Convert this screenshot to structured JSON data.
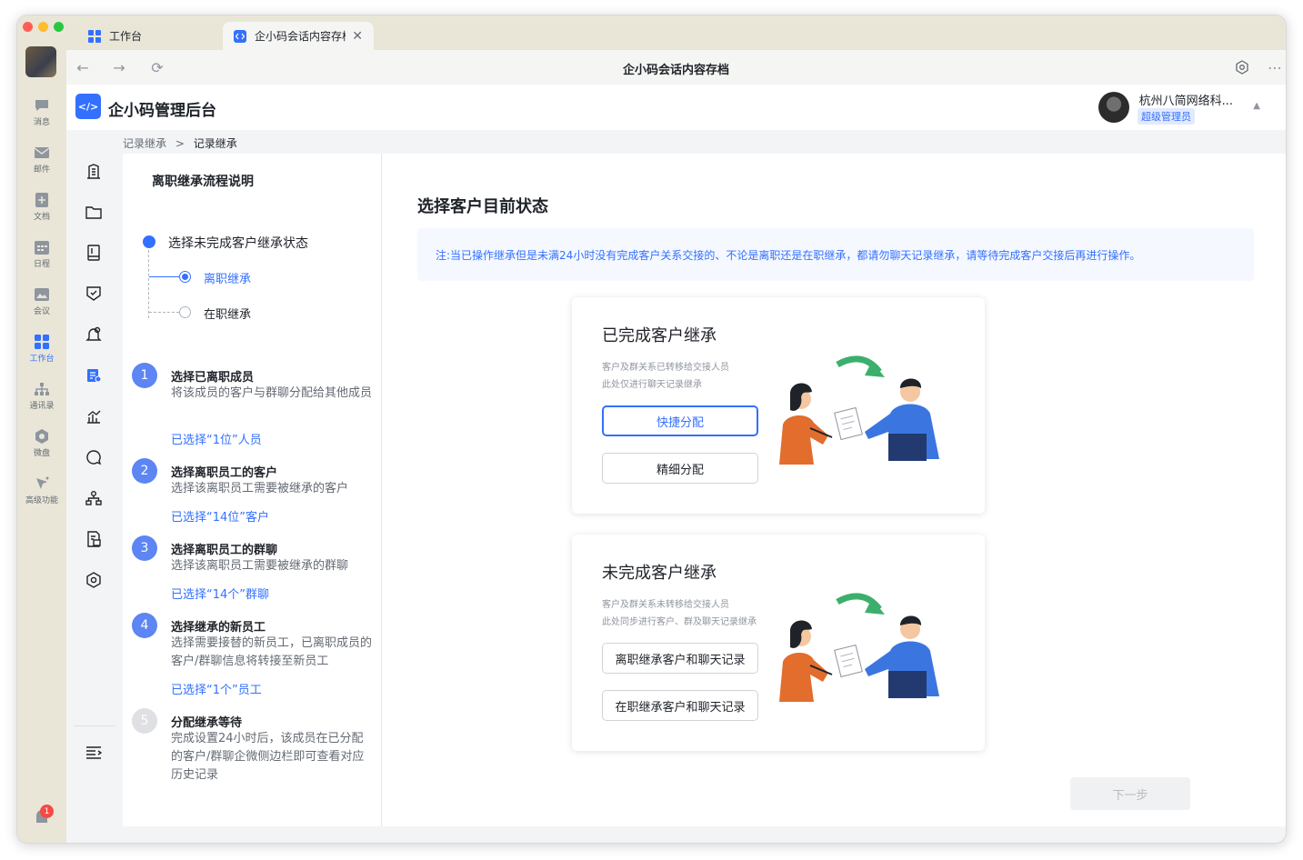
{
  "window": {
    "tabs": [
      {
        "label": "工作台",
        "icon": "grid-icon"
      },
      {
        "label": "企小码会话内容存档",
        "icon": "code-icon"
      }
    ],
    "title": "企小码会话内容存档"
  },
  "rail": {
    "items": [
      {
        "label": "消息",
        "icon": "chat-icon"
      },
      {
        "label": "邮件",
        "icon": "mail-icon"
      },
      {
        "label": "文档",
        "icon": "doc-icon"
      },
      {
        "label": "日程",
        "icon": "calendar-icon"
      },
      {
        "label": "会议",
        "icon": "meeting-icon"
      },
      {
        "label": "工作台",
        "icon": "grid-icon"
      },
      {
        "label": "通讯录",
        "icon": "org-icon"
      },
      {
        "label": "微盘",
        "icon": "drive-icon"
      },
      {
        "label": "高级功能",
        "icon": "sparkle-icon"
      }
    ],
    "badge": "1"
  },
  "header": {
    "logo_text": "</>",
    "app_title": "企小码管理后台",
    "company": "杭州八简网络科...",
    "role": "超级管理员"
  },
  "breadcrumb": {
    "parent": "记录继承",
    "separator": ">",
    "current": "记录继承"
  },
  "steps": {
    "title": "离职继承流程说明",
    "tree_head": "选择未完成客户继承状态",
    "options": [
      "离职继承",
      "在职继承"
    ],
    "items": [
      {
        "num": "1",
        "title": "选择已离职成员",
        "desc": "将该成员的客户与群聊分配给其他成员",
        "selected": "已选择“1位”人员"
      },
      {
        "num": "2",
        "title": "选择离职员工的客户",
        "desc": "选择该离职员工需要被继承的客户",
        "selected": "已选择“14位”客户"
      },
      {
        "num": "3",
        "title": "选择离职员工的群聊",
        "desc": "选择该离职员工需要被继承的群聊",
        "selected": "已选择“14个”群聊"
      },
      {
        "num": "4",
        "title": "选择继承的新员工",
        "desc": "选择需要接替的新员工，已离职成员的客户/群聊信息将转接至新员工",
        "selected": "已选择“1个”员工"
      },
      {
        "num": "5",
        "title": "分配继承等待",
        "desc": "完成设置24小时后，该成员在已分配的客户/群聊企微侧边栏即可查看对应历史记录",
        "selected": ""
      }
    ]
  },
  "main": {
    "title": "选择客户目前状态",
    "notice": "注:当已操作继承但是未满24小时没有完成客户关系交接的、不论是离职还是在职继承，都请勿聊天记录继承，请等待完成客户交接后再进行操作。",
    "cards": [
      {
        "title": "已完成客户继承",
        "desc1": "客户及群关系已转移给交接人员",
        "desc2": "此处仅进行聊天记录继承",
        "btn1": "快捷分配",
        "btn2": "精细分配"
      },
      {
        "title": "未完成客户继承",
        "desc1": "客户及群关系未转移给交接人员",
        "desc2": "此处同步进行客户、群及聊天记录继承",
        "btn1": "离职继承客户和聊天记录",
        "btn2": "在职继承客户和聊天记录"
      }
    ],
    "next": "下一步"
  },
  "colors": {
    "accent": "#3370ff",
    "rail_bg": "#e9e6d8",
    "notice_bg": "#f5f8ff"
  }
}
